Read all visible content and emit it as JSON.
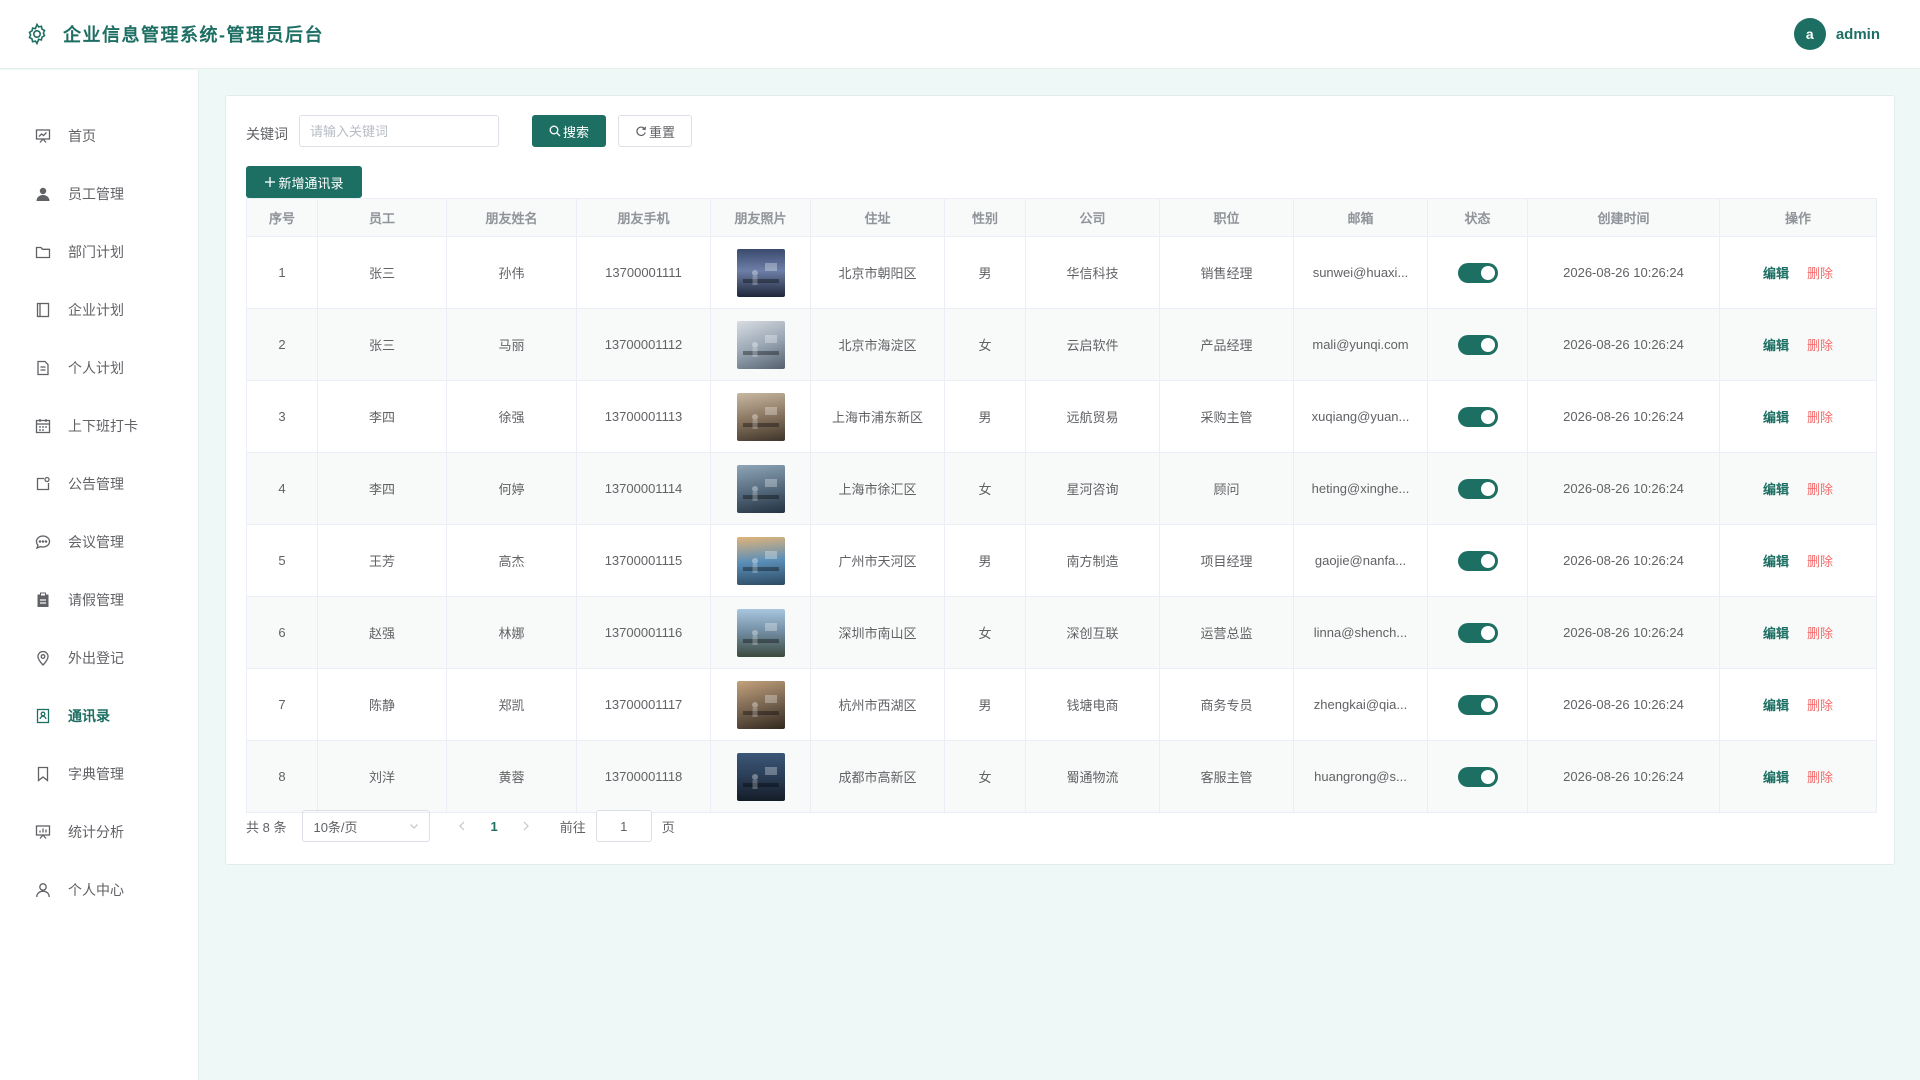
{
  "header": {
    "title": "企业信息管理系统-管理员后台",
    "avatar_letter": "a",
    "username": "admin"
  },
  "sidebar": {
    "items": [
      {
        "label": "首页",
        "icon": "dashboard-icon"
      },
      {
        "label": "员工管理",
        "icon": "user-solid-icon"
      },
      {
        "label": "部门计划",
        "icon": "folder-icon"
      },
      {
        "label": "企业计划",
        "icon": "notebook-icon"
      },
      {
        "label": "个人计划",
        "icon": "document-icon"
      },
      {
        "label": "上下班打卡",
        "icon": "calendar-icon"
      },
      {
        "label": "公告管理",
        "icon": "notice-icon"
      },
      {
        "label": "会议管理",
        "icon": "chat-icon"
      },
      {
        "label": "请假管理",
        "icon": "clipboard-icon"
      },
      {
        "label": "外出登记",
        "icon": "location-icon"
      },
      {
        "label": "通讯录",
        "icon": "contacts-icon",
        "active": true
      },
      {
        "label": "字典管理",
        "icon": "bookmark-icon"
      },
      {
        "label": "统计分析",
        "icon": "data-board-icon"
      },
      {
        "label": "个人中心",
        "icon": "user-icon"
      }
    ]
  },
  "toolbar": {
    "keyword_label": "关键词",
    "keyword_placeholder": "请输入关键词",
    "keyword_value": "",
    "search_label": "搜索",
    "reset_label": "重置",
    "add_label": "新增通讯录"
  },
  "table": {
    "headers": [
      "序号",
      "员工",
      "朋友姓名",
      "朋友手机",
      "朋友照片",
      "住址",
      "性别",
      "公司",
      "职位",
      "邮箱",
      "状态",
      "创建时间",
      "操作"
    ],
    "rows": [
      {
        "index": "1",
        "employee": "张三",
        "friend_name": "孙伟",
        "phone": "13700001111",
        "photo": "office-night-window-photo",
        "address": "北京市朝阳区",
        "gender": "男",
        "company": "华信科技",
        "position": "销售经理",
        "email": "sunwei@huaxi...",
        "status": true,
        "created": "2026-08-26 10:26:24"
      },
      {
        "index": "2",
        "employee": "张三",
        "friend_name": "马丽",
        "phone": "13700001112",
        "photo": "office-desk-photo",
        "address": "北京市海淀区",
        "gender": "女",
        "company": "云启软件",
        "position": "产品经理",
        "email": "mali@yunqi.com",
        "status": true,
        "created": "2026-08-26 10:26:24"
      },
      {
        "index": "3",
        "employee": "李四",
        "friend_name": "徐强",
        "phone": "13700001113",
        "photo": "office-meeting-photo",
        "address": "上海市浦东新区",
        "gender": "男",
        "company": "远航贸易",
        "position": "采购主管",
        "email": "xuqiang@yuan...",
        "status": true,
        "created": "2026-08-26 10:26:24"
      },
      {
        "index": "4",
        "employee": "李四",
        "friend_name": "何婷",
        "phone": "13700001114",
        "photo": "office-standing-photo",
        "address": "上海市徐汇区",
        "gender": "女",
        "company": "星河咨询",
        "position": "顾问",
        "email": "heting@xinghe...",
        "status": true,
        "created": "2026-08-26 10:26:24"
      },
      {
        "index": "5",
        "employee": "王芳",
        "friend_name": "高杰",
        "phone": "13700001115",
        "photo": "workshop-photo",
        "address": "广州市天河区",
        "gender": "男",
        "company": "南方制造",
        "position": "项目经理",
        "email": "gaojie@nanfa...",
        "status": true,
        "created": "2026-08-26 10:26:24"
      },
      {
        "index": "6",
        "employee": "赵强",
        "friend_name": "林娜",
        "phone": "13700001116",
        "photo": "street-building-photo",
        "address": "深圳市南山区",
        "gender": "女",
        "company": "深创互联",
        "position": "运营总监",
        "email": "linna@shench...",
        "status": true,
        "created": "2026-08-26 10:26:24"
      },
      {
        "index": "7",
        "employee": "陈静",
        "friend_name": "郑凯",
        "phone": "13700001117",
        "photo": "team-table-photo",
        "address": "杭州市西湖区",
        "gender": "男",
        "company": "钱塘电商",
        "position": "商务专员",
        "email": "zhengkai@qia...",
        "status": true,
        "created": "2026-08-26 10:26:24"
      },
      {
        "index": "8",
        "employee": "刘洋",
        "friend_name": "黄蓉",
        "phone": "13700001118",
        "photo": "control-room-photo",
        "address": "成都市高新区",
        "gender": "女",
        "company": "蜀通物流",
        "position": "客服主管",
        "email": "huangrong@s...",
        "status": true,
        "created": "2026-08-26 10:26:24"
      }
    ],
    "edit_label": "编辑",
    "delete_label": "删除"
  },
  "pagination": {
    "total_text": "共 8 条",
    "page_size": "10条/页",
    "current_page": "1",
    "goto_label": "前往",
    "goto_value": "1",
    "page_suffix": "页"
  },
  "colors": {
    "primary": "#1e6f63",
    "danger": "#f56c6c",
    "background": "#eef8f6"
  }
}
